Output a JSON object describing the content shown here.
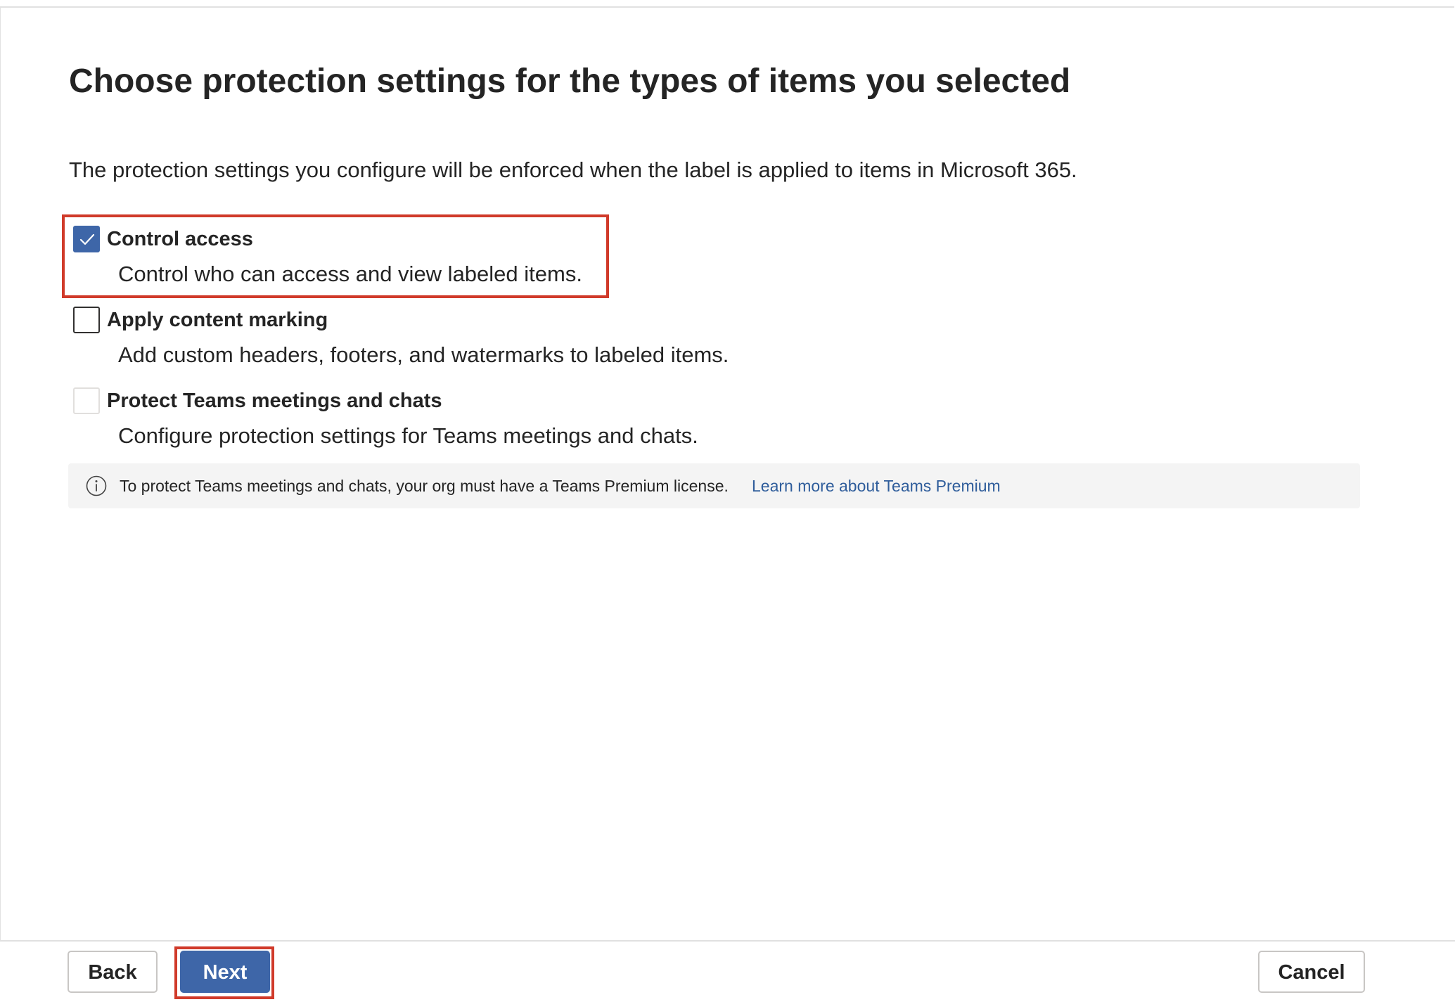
{
  "header": {
    "title": "Choose protection settings for the types of items you selected",
    "intro": "The protection settings you configure will be enforced when the label is applied to items in Microsoft 365."
  },
  "options": [
    {
      "label": "Control access",
      "description": "Control who can access and view labeled items.",
      "checked": true,
      "enabled": true,
      "highlighted": true
    },
    {
      "label": "Apply content marking",
      "description": "Add custom headers, footers, and watermarks to labeled items.",
      "checked": false,
      "enabled": true,
      "highlighted": false
    },
    {
      "label": "Protect Teams meetings and chats",
      "description": "Configure protection settings for Teams meetings and chats.",
      "checked": false,
      "enabled": false,
      "highlighted": false
    }
  ],
  "info_bar": {
    "icon": "info-icon",
    "text": "To protect Teams meetings and chats, your org must have a Teams Premium license.",
    "link_text": "Learn more about Teams Premium"
  },
  "footer": {
    "back_label": "Back",
    "next_label": "Next",
    "cancel_label": "Cancel",
    "next_highlighted": true
  },
  "colors": {
    "accent": "#3e66a8",
    "highlight": "#d03a2a",
    "link": "#2f5d9b",
    "info_background": "#f4f4f4"
  }
}
